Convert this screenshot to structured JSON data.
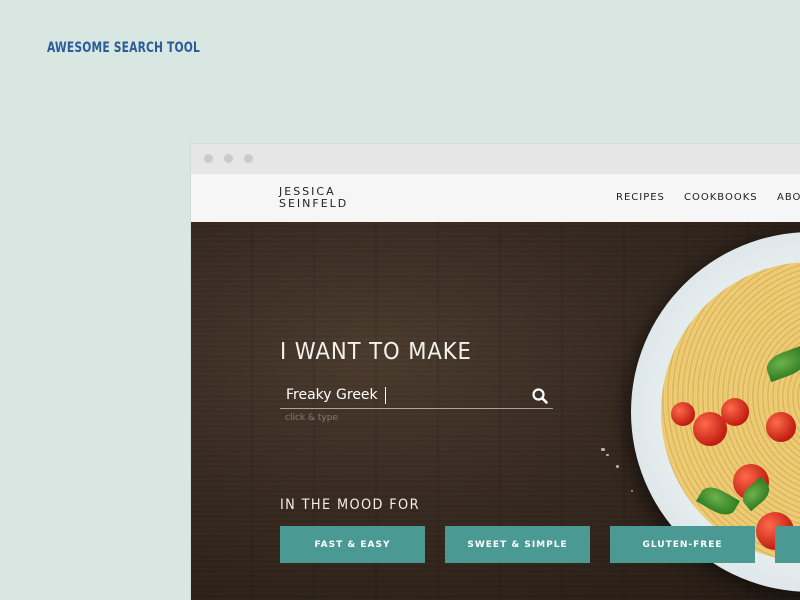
{
  "page_label": "AWESOME SEARCH TOOL",
  "browser": {
    "site": {
      "logo_line1": "JESSICA",
      "logo_line2": "SEINFELD",
      "nav": [
        "RECIPES",
        "COOKBOOKS",
        "ABO"
      ]
    },
    "hero": {
      "headline": "I WANT TO MAKE",
      "search": {
        "value": "Freaky Greek",
        "hint": "click & type"
      },
      "mood_heading": "IN THE MOOD FOR",
      "mood_buttons": [
        "FAST & EASY",
        "SWEET & SIMPLE",
        "GLUTEN-FREE",
        ""
      ]
    }
  },
  "colors": {
    "background": "#d8e7e2",
    "label_blue": "#2b5c97",
    "button_teal": "#4a9a93",
    "header_bg": "#f6f6f6",
    "chrome_bg": "#e6e6e6"
  },
  "icons": [
    "search-icon"
  ]
}
